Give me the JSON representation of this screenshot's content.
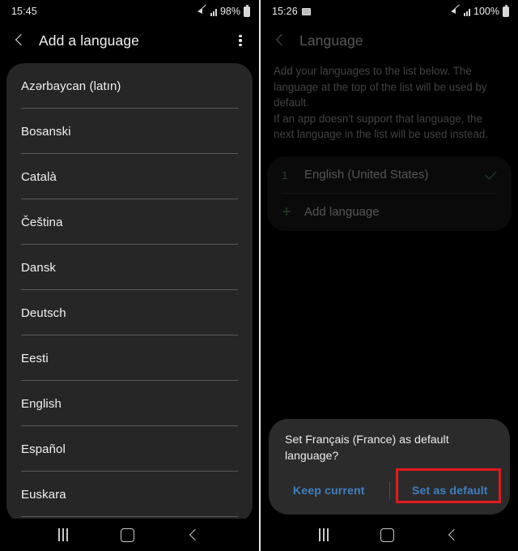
{
  "left_screen": {
    "status_bar": {
      "clock": "15:45",
      "battery_percent": "98%",
      "icons": [
        "mute-icon",
        "signal-icon",
        "battery-icon"
      ]
    },
    "app_bar": {
      "back_icon": "back-chevron-icon",
      "title": "Add a language",
      "overflow_icon": "overflow-menu-icon"
    },
    "languages": [
      "Azərbaycan (latın)",
      "Bosanski",
      "Català",
      "Čeština",
      "Dansk",
      "Deutsch",
      "Eesti",
      "English",
      "Español",
      "Euskara"
    ],
    "nav_bar": {
      "recents": "recents-icon",
      "home": "home-icon",
      "back": "back-icon"
    }
  },
  "right_screen": {
    "status_bar": {
      "clock": "15:26",
      "battery_percent": "100%",
      "icons": [
        "photo-icon",
        "mute-icon",
        "signal-icon",
        "battery-icon"
      ]
    },
    "app_bar": {
      "back_icon": "back-chevron-icon",
      "title": "Language"
    },
    "description": [
      "Add your languages to the list below. The language at the top of the list will be used by default.",
      "If an app doesn't support that language, the next language in the list will be used instead."
    ],
    "language_items": [
      {
        "index": "1",
        "label": "English (United States)",
        "checked": true
      },
      {
        "index": "+",
        "label": "Add language",
        "checked": false
      }
    ],
    "dialog": {
      "message": "Set Français (France) as default language?",
      "keep_label": "Keep current",
      "default_label": "Set as default",
      "accent_color": "#3f7fc0",
      "highlight_color": "#e01b1b"
    },
    "nav_bar": {
      "recents": "recents-icon",
      "home": "home-icon",
      "back": "back-icon"
    }
  }
}
